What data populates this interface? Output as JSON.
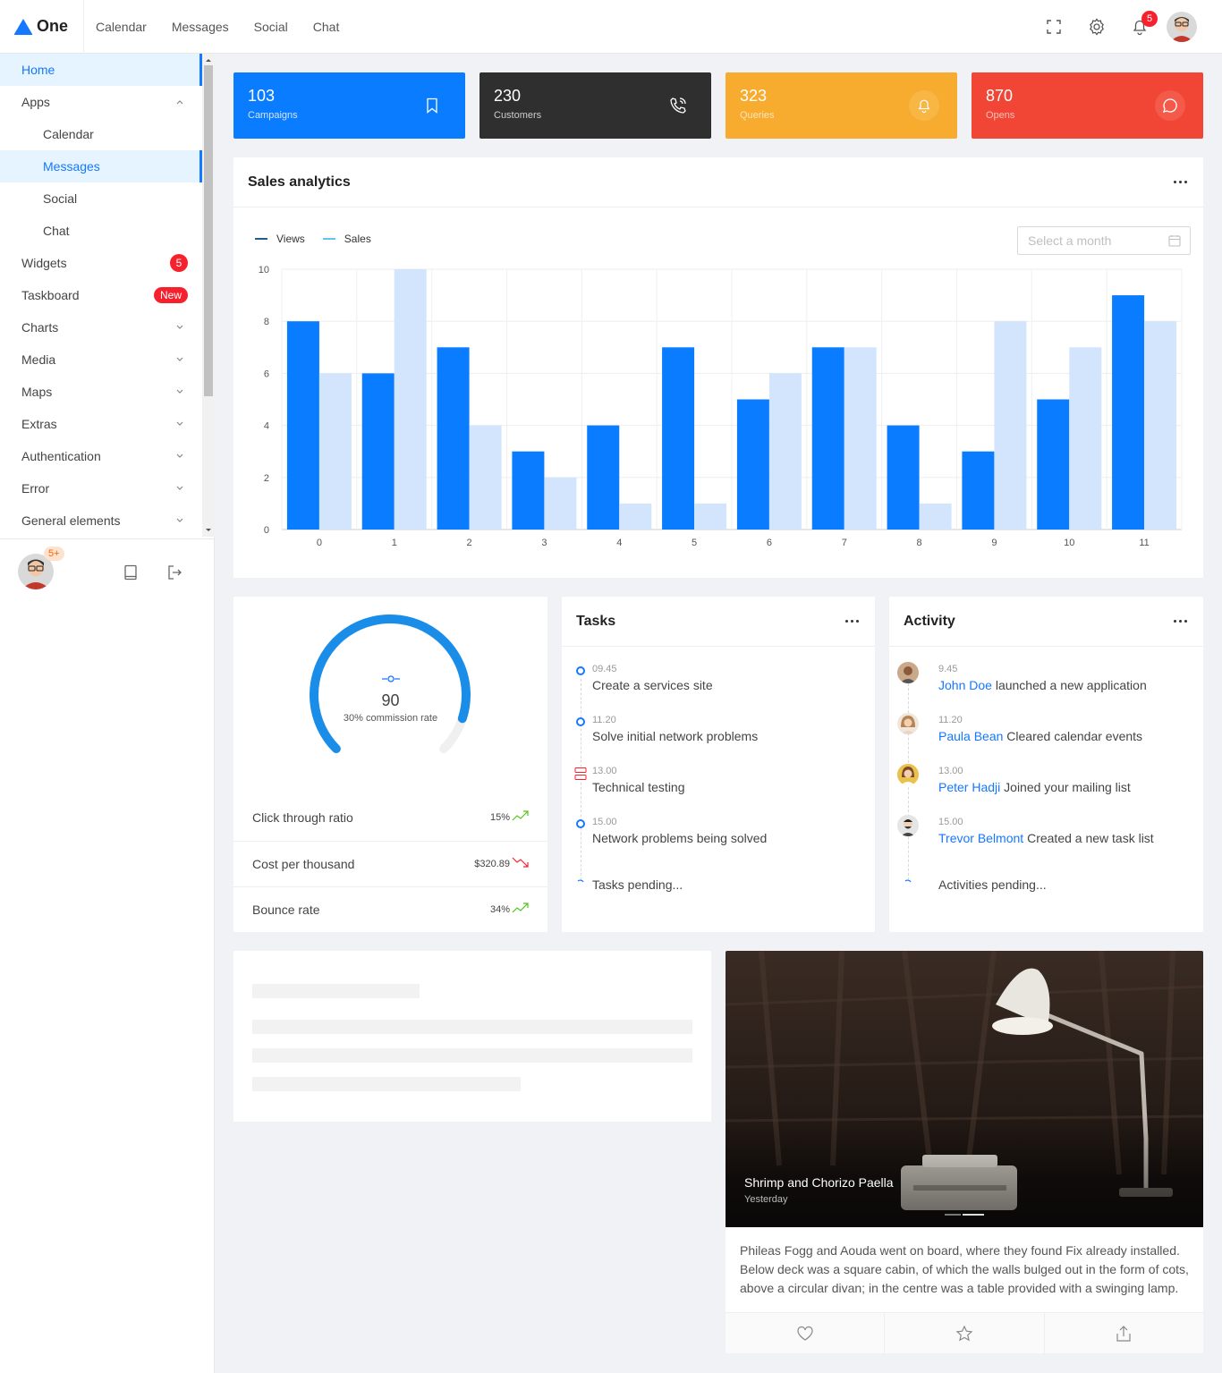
{
  "brand": {
    "name": "One",
    "accent": "#1677ff"
  },
  "topnav": [
    "Calendar",
    "Messages",
    "Social",
    "Chat"
  ],
  "topbar": {
    "notification_count": "5",
    "icons": [
      "fullscreen-icon",
      "settings-icon",
      "bell-icon",
      "user-avatar"
    ]
  },
  "sidebar": {
    "items": [
      {
        "label": "Home",
        "active": true
      },
      {
        "label": "Apps",
        "expanded": true
      },
      {
        "label": "Calendar",
        "sub": true
      },
      {
        "label": "Messages",
        "sub": true,
        "active": true
      },
      {
        "label": "Social",
        "sub": true
      },
      {
        "label": "Chat",
        "sub": true
      },
      {
        "label": "Widgets",
        "badge": "5"
      },
      {
        "label": "Taskboard",
        "badge": "New"
      },
      {
        "label": "Charts"
      },
      {
        "label": "Media"
      },
      {
        "label": "Maps"
      },
      {
        "label": "Extras"
      },
      {
        "label": "Authentication"
      },
      {
        "label": "Error"
      },
      {
        "label": "General elements"
      }
    ],
    "footer_badge": "5+"
  },
  "stats": [
    {
      "value": "103",
      "label": "Campaigns",
      "color": "#0a7cff",
      "icon": "bookmark-icon"
    },
    {
      "value": "230",
      "label": "Customers",
      "color": "#2f2f2f",
      "icon": "phone-call-icon"
    },
    {
      "value": "323",
      "label": "Queries",
      "color": "#f7ac2f",
      "icon": "bell-icon"
    },
    {
      "value": "870",
      "label": "Opens",
      "color": "#f14635",
      "icon": "message-icon"
    }
  ],
  "sales": {
    "title": "Sales analytics",
    "month_placeholder": "Select a month",
    "legend": [
      "Views",
      "Sales"
    ]
  },
  "chart_data": {
    "type": "bar",
    "categories": [
      "0",
      "1",
      "2",
      "3",
      "4",
      "5",
      "6",
      "7",
      "8",
      "9",
      "10",
      "11"
    ],
    "series": [
      {
        "name": "Views",
        "values": [
          8,
          6,
          7,
          3,
          4,
          7,
          5,
          7,
          4,
          3,
          5,
          9
        ],
        "color": "#0a7cff"
      },
      {
        "name": "Sales",
        "values": [
          6,
          10,
          4,
          2,
          1,
          1,
          6,
          7,
          1,
          8,
          7,
          8
        ],
        "color": "#d2e5fd"
      }
    ],
    "ylim": [
      0,
      10
    ],
    "yticks": [
      "0",
      "2",
      "4",
      "6",
      "8",
      "10"
    ],
    "grid": true,
    "legend": "top-left"
  },
  "gauge": {
    "value": "90",
    "caption": "30% commission rate",
    "percent": 90,
    "rows": [
      {
        "label": "Click through ratio",
        "value": "15%",
        "trend": "up"
      },
      {
        "label": "Cost per thousand",
        "value": "$320.89",
        "trend": "down"
      },
      {
        "label": "Bounce rate",
        "value": "34%",
        "trend": "up"
      }
    ]
  },
  "tasks": {
    "title": "Tasks",
    "items": [
      {
        "time": "09.45",
        "text": "Create a services site"
      },
      {
        "time": "11.20",
        "text": "Solve initial network problems"
      },
      {
        "time": "13.00",
        "text": "Technical testing"
      },
      {
        "time": "15.00",
        "text": "Network problems being solved"
      }
    ],
    "pending": "Tasks pending..."
  },
  "activity": {
    "title": "Activity",
    "items": [
      {
        "time": "9.45",
        "name": "John Doe",
        "text": "launched a new application"
      },
      {
        "time": "11.20",
        "name": "Paula Bean",
        "text": "Cleared calendar events"
      },
      {
        "time": "13.00",
        "name": "Peter Hadji",
        "text": "Joined your mailing list"
      },
      {
        "time": "15.00",
        "name": "Trevor Belmont",
        "text": "Created a new task list"
      }
    ],
    "pending": "Activities pending..."
  },
  "blog": {
    "title": "Shrimp and Chorizo Paella",
    "subtitle": "Yesterday",
    "body": "Phileas Fogg and Aouda went on board, where they found Fix already installed. Below deck was a square cabin, of which the walls bulged out in the form of cots, above a circular divan; in the centre was a table provided with a swinging lamp."
  }
}
